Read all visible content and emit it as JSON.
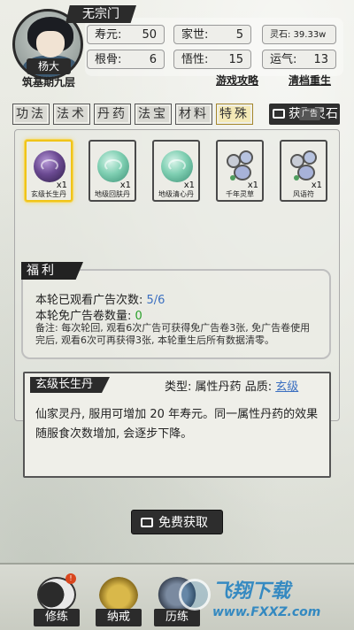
{
  "header": {
    "sect": "无宗门",
    "player_name": "杨大",
    "realm": "筑基期九层",
    "stats": {
      "lifespan_label": "寿元:",
      "lifespan_value": "50",
      "family_label": "家世:",
      "family_value": "5",
      "root_label": "根骨:",
      "root_value": "6",
      "insight_label": "悟性:",
      "insight_value": "15",
      "luck_label": "运气:",
      "luck_value": "13",
      "spirit_stone": "灵石: 39.33w"
    },
    "links": {
      "guide": "游戏攻略",
      "reset": "清档重生"
    }
  },
  "tabs": [
    {
      "label": "功法"
    },
    {
      "label": "法术"
    },
    {
      "label": "丹药"
    },
    {
      "label": "法宝"
    },
    {
      "label": "材料"
    },
    {
      "label": "特殊"
    }
  ],
  "get_stone": {
    "label": "获取灵石",
    "badge": "广告"
  },
  "items": [
    {
      "name": "玄级长生丹",
      "qty": "x1",
      "icon": "purple-pill-icon"
    },
    {
      "name": "地级回肤丹",
      "qty": "x1",
      "icon": "green-pill-icon"
    },
    {
      "name": "地级清心丹",
      "qty": "x1",
      "icon": "green-pill-icon"
    },
    {
      "name": "千年灵草",
      "qty": "x1",
      "icon": "herb-icon"
    },
    {
      "name": "风语符",
      "qty": "x1",
      "icon": "herb-icon"
    }
  ],
  "welfare": {
    "title": "福利",
    "watched_label": "本轮已观看广告次数:",
    "watched_value": "5/6",
    "coupon_label": "本轮免广告卷数量:",
    "coupon_value": "0",
    "note": "备注: 每次轮回, 观看6次广告可获得免广告卷3张, 免广告卷使用完后, 观看6次可再获得3张, 本轮重生后所有数据清零。"
  },
  "detail": {
    "title": "玄级长生丹",
    "type_label": "类型:",
    "type_value": "属性丹药",
    "grade_label": "品质:",
    "grade_value": "玄级",
    "body": "仙家灵丹, 服用可增加 20 年寿元。同一属性丹药的效果随服食次数增加, 会逐步下降。"
  },
  "free_button": {
    "label": "免费获取"
  },
  "nav": [
    {
      "label": "修练",
      "icon": "yin-yang-icon",
      "badge": "!"
    },
    {
      "label": "纳戒",
      "icon": "ring-pouch-icon"
    },
    {
      "label": "历练",
      "icon": "journey-icon"
    }
  ],
  "watermark": {
    "brand": "飞翔下载",
    "site": "www.FXXZ.com"
  },
  "colors": {
    "accent_gold": "#f0c419",
    "link_blue": "#3b6fc0",
    "green": "#2aa02a"
  }
}
